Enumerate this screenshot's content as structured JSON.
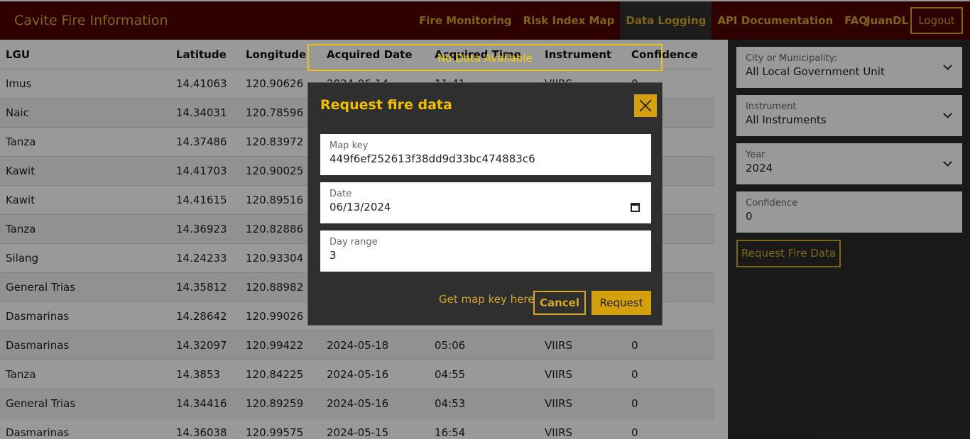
{
  "header": {
    "title": "Cavite Fire Information",
    "nav": [
      {
        "label": "Fire Monitoring",
        "active": false
      },
      {
        "label": "Risk Index Map",
        "active": false
      },
      {
        "label": "Data Logging",
        "active": true
      },
      {
        "label": "API Documentation",
        "active": false
      },
      {
        "label": "FAQ",
        "active": false
      }
    ],
    "user": "JuanDL",
    "logout_label": "Logout"
  },
  "table": {
    "headers": [
      "LGU",
      "Latitude",
      "Longitude",
      "Acquired Date",
      "Acquired Time",
      "Instrument",
      "Confidence"
    ],
    "rows": [
      {
        "lgu": "Imus",
        "lat": "14.41063",
        "lon": "120.90626",
        "date": "2024-06-14",
        "time": "11:41",
        "inst": "VIIRS",
        "conf": "0"
      },
      {
        "lgu": "Naic",
        "lat": "14.34031",
        "lon": "120.78596",
        "date": "",
        "time": "",
        "inst": "",
        "conf": ""
      },
      {
        "lgu": "Tanza",
        "lat": "14.37486",
        "lon": "120.83972",
        "date": "",
        "time": "",
        "inst": "",
        "conf": ""
      },
      {
        "lgu": "Kawit",
        "lat": "14.41703",
        "lon": "120.90025",
        "date": "",
        "time": "",
        "inst": "",
        "conf": ""
      },
      {
        "lgu": "Kawit",
        "lat": "14.41615",
        "lon": "120.89516",
        "date": "",
        "time": "",
        "inst": "",
        "conf": ""
      },
      {
        "lgu": "Tanza",
        "lat": "14.36923",
        "lon": "120.82886",
        "date": "",
        "time": "",
        "inst": "",
        "conf": ""
      },
      {
        "lgu": "Silang",
        "lat": "14.24233",
        "lon": "120.93304",
        "date": "",
        "time": "",
        "inst": "",
        "conf": ""
      },
      {
        "lgu": "General Trias",
        "lat": "14.35812",
        "lon": "120.88982",
        "date": "",
        "time": "",
        "inst": "",
        "conf": ""
      },
      {
        "lgu": "Dasmarinas",
        "lat": "14.28642",
        "lon": "120.99026",
        "date": "",
        "time": "",
        "inst": "",
        "conf": ""
      },
      {
        "lgu": "Dasmarinas",
        "lat": "14.32097",
        "lon": "120.99422",
        "date": "2024-05-18",
        "time": "05:06",
        "inst": "VIIRS",
        "conf": "0"
      },
      {
        "lgu": "Tanza",
        "lat": "14.3853",
        "lon": "120.84225",
        "date": "2024-05-16",
        "time": "04:55",
        "inst": "VIIRS",
        "conf": "0"
      },
      {
        "lgu": "General Trias",
        "lat": "14.34416",
        "lon": "120.89259",
        "date": "2024-05-16",
        "time": "04:53",
        "inst": "VIIRS",
        "conf": "0"
      },
      {
        "lgu": "Dasmarinas",
        "lat": "14.36038",
        "lon": "120.99575",
        "date": "2024-05-15",
        "time": "16:54",
        "inst": "VIIRS",
        "conf": "0"
      }
    ]
  },
  "sidebar": {
    "fields": [
      {
        "label": "City or Municipality:",
        "value": "All Local Government Unit",
        "dropdown": true
      },
      {
        "label": "Instrument",
        "value": "All Instruments",
        "dropdown": true
      },
      {
        "label": "Year",
        "value": "2024",
        "dropdown": true
      },
      {
        "label": "Confidence",
        "value": "0",
        "dropdown": false
      }
    ],
    "request_label": "Request Fire Data"
  },
  "alert": {
    "text": "No Data Available"
  },
  "dialog": {
    "title": "Request fire data",
    "fields": [
      {
        "label": "Map key",
        "value": "449f6ef252613f38dd9d33bc474883c6"
      },
      {
        "label": "Date",
        "value": "06/13/2024"
      },
      {
        "label": "Day range",
        "value": "3"
      }
    ],
    "mapkey_link": "Get map key here",
    "cancel_label": "Cancel",
    "request_label": "Request"
  },
  "colors": {
    "header_bg": "#4d0000",
    "accent": "#d4a827",
    "button_bg": "#d4a10c",
    "sidebar_bg": "#2b2b2b",
    "dialog_bg": "#2f2f2f",
    "alert": "#f0d000"
  }
}
